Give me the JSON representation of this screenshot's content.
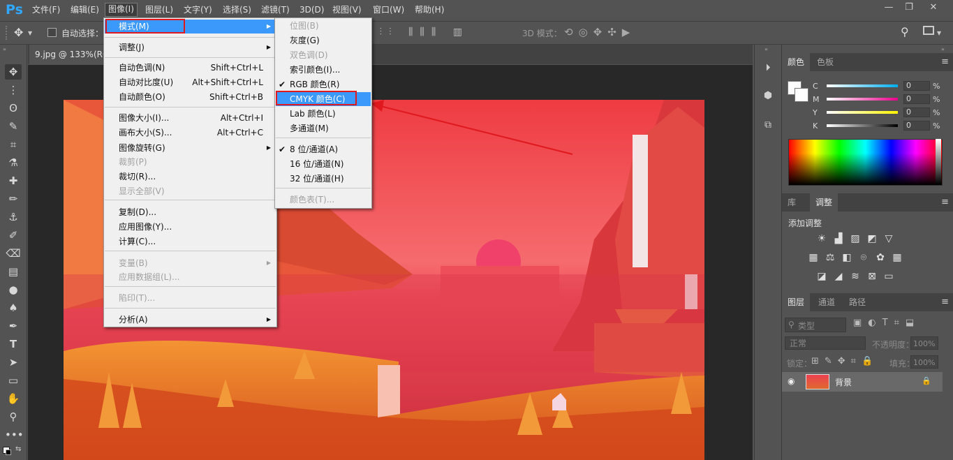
{
  "app": {
    "logo": "Ps"
  },
  "menubar": [
    "文件(F)",
    "编辑(E)",
    "图像(I)",
    "图层(L)",
    "文字(Y)",
    "选择(S)",
    "滤镜(T)",
    "3D(D)",
    "视图(V)",
    "窗口(W)",
    "帮助(H)"
  ],
  "window_buttons": {
    "minimize": "—",
    "restore": "❐",
    "close": "✕"
  },
  "options": {
    "auto_select": "自动选择：",
    "mode_3d": "3D 模式："
  },
  "document_tab": "9.jpg @ 133%(RGB",
  "image_menu": {
    "items": [
      {
        "label": "模式(M)",
        "shortcut": "",
        "arrow": true,
        "disabled": false,
        "highlight": true
      },
      {
        "label": "调整(J)",
        "shortcut": "",
        "arrow": true,
        "disabled": false
      },
      {
        "label": "自动色调(N)",
        "shortcut": "Shift+Ctrl+L",
        "arrow": false,
        "disabled": false
      },
      {
        "label": "自动对比度(U)",
        "shortcut": "Alt+Shift+Ctrl+L",
        "arrow": false,
        "disabled": false
      },
      {
        "label": "自动颜色(O)",
        "shortcut": "Shift+Ctrl+B",
        "arrow": false,
        "disabled": false
      },
      {
        "label": "图像大小(I)...",
        "shortcut": "Alt+Ctrl+I",
        "arrow": false,
        "disabled": false
      },
      {
        "label": "画布大小(S)...",
        "shortcut": "Alt+Ctrl+C",
        "arrow": false,
        "disabled": false
      },
      {
        "label": "图像旋转(G)",
        "shortcut": "",
        "arrow": true,
        "disabled": false
      },
      {
        "label": "裁剪(P)",
        "shortcut": "",
        "arrow": false,
        "disabled": true
      },
      {
        "label": "裁切(R)...",
        "shortcut": "",
        "arrow": false,
        "disabled": false
      },
      {
        "label": "显示全部(V)",
        "shortcut": "",
        "arrow": false,
        "disabled": true
      },
      {
        "label": "复制(D)...",
        "shortcut": "",
        "arrow": false,
        "disabled": false
      },
      {
        "label": "应用图像(Y)...",
        "shortcut": "",
        "arrow": false,
        "disabled": false
      },
      {
        "label": "计算(C)...",
        "shortcut": "",
        "arrow": false,
        "disabled": false
      },
      {
        "label": "变量(B)",
        "shortcut": "",
        "arrow": true,
        "disabled": true
      },
      {
        "label": "应用数据组(L)...",
        "shortcut": "",
        "arrow": false,
        "disabled": true
      },
      {
        "label": "陷印(T)...",
        "shortcut": "",
        "arrow": false,
        "disabled": true
      },
      {
        "label": "分析(A)",
        "shortcut": "",
        "arrow": true,
        "disabled": false
      }
    ]
  },
  "mode_submenu": {
    "items": [
      {
        "label": "位图(B)",
        "disabled": true,
        "checked": false
      },
      {
        "label": "灰度(G)",
        "disabled": false,
        "checked": false
      },
      {
        "label": "双色调(D)",
        "disabled": true,
        "checked": false
      },
      {
        "label": "索引颜色(I)...",
        "disabled": false,
        "checked": false
      },
      {
        "label": "RGB 颜色(R)",
        "disabled": false,
        "checked": true
      },
      {
        "label": "CMYK 颜色(C)",
        "disabled": false,
        "checked": false,
        "highlight": true
      },
      {
        "label": "Lab 颜色(L)",
        "disabled": false,
        "checked": false
      },
      {
        "label": "多通道(M)",
        "disabled": false,
        "checked": false
      },
      {
        "label": "8 位/通道(A)",
        "disabled": false,
        "checked": true
      },
      {
        "label": "16 位/通道(N)",
        "disabled": false,
        "checked": false
      },
      {
        "label": "32 位/通道(H)",
        "disabled": false,
        "checked": false
      },
      {
        "label": "颜色表(T)...",
        "disabled": true,
        "checked": false
      }
    ]
  },
  "color_panel": {
    "tabs": [
      "颜色",
      "色板"
    ],
    "channels": [
      {
        "label": "C",
        "value": "0",
        "pct": "%",
        "gradient": "#00aeef"
      },
      {
        "label": "M",
        "value": "0",
        "pct": "%",
        "gradient": "#ec008c"
      },
      {
        "label": "Y",
        "value": "0",
        "pct": "%",
        "gradient": "#fff200"
      },
      {
        "label": "K",
        "value": "0",
        "pct": "%",
        "gradient": "#000000"
      }
    ]
  },
  "adjust_panel": {
    "tabs": [
      "库",
      "调整"
    ],
    "title": "添加调整"
  },
  "layers_panel": {
    "tabs": [
      "图层",
      "通道",
      "路径"
    ],
    "filter": "类型",
    "blend": "正常",
    "opacity_label": "不透明度：",
    "opacity": "100%",
    "lock_label": "锁定：",
    "fill_label": "填充：",
    "fill": "100%",
    "layer_name": "背景"
  },
  "colors": {
    "accent": "#3c99fc",
    "annotation": "#e0191f",
    "logo": "#31a8ff"
  }
}
